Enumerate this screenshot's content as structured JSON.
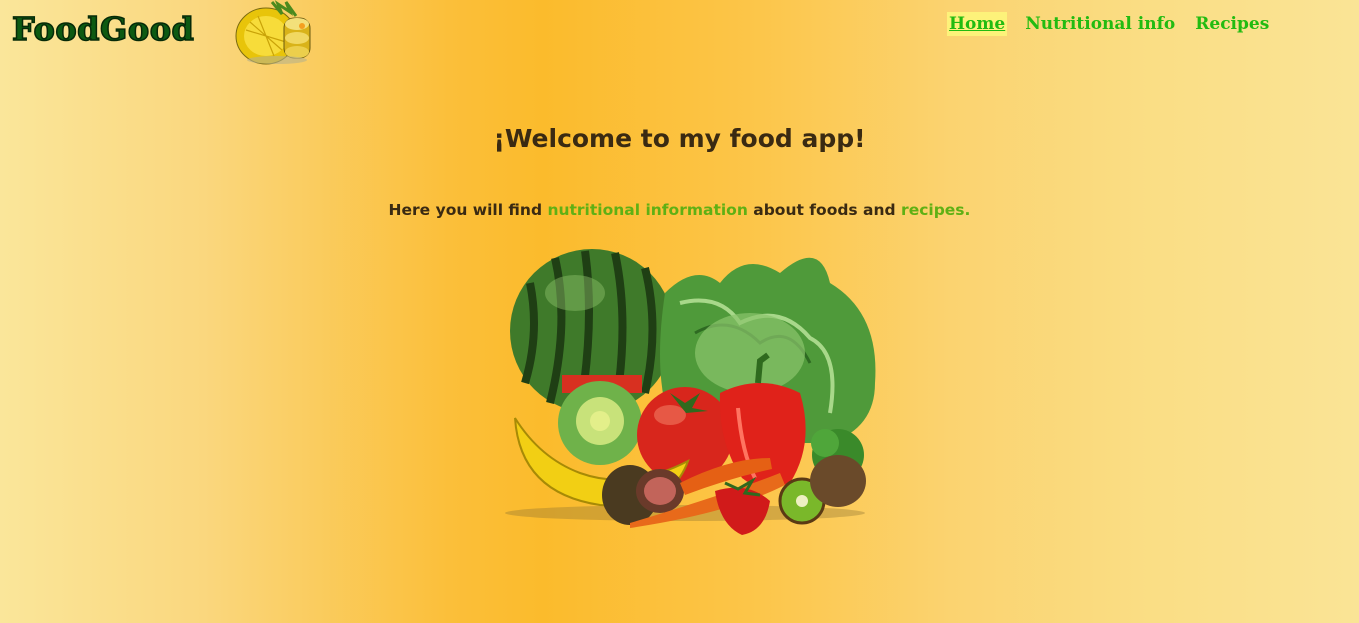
{
  "header": {
    "brand": "FoodGood",
    "logo_icon": "pineapple-icon"
  },
  "nav": {
    "items": [
      {
        "label": "Home",
        "active": true
      },
      {
        "label": "Nutritional info",
        "active": false
      },
      {
        "label": "Recipes",
        "active": false
      }
    ]
  },
  "main": {
    "title": "¡Welcome to my food app!",
    "intro_prefix": "Here you will find ",
    "intro_link1": "nutritional information",
    "intro_middle": " about foods and ",
    "intro_link2": "recipes.",
    "hero_image": "fruits-vegetables-illustration"
  },
  "colors": {
    "nav_link": "#22bb11",
    "brand": "#0d5a12",
    "text_link": "#5fb014",
    "heading": "#3a2a12"
  }
}
